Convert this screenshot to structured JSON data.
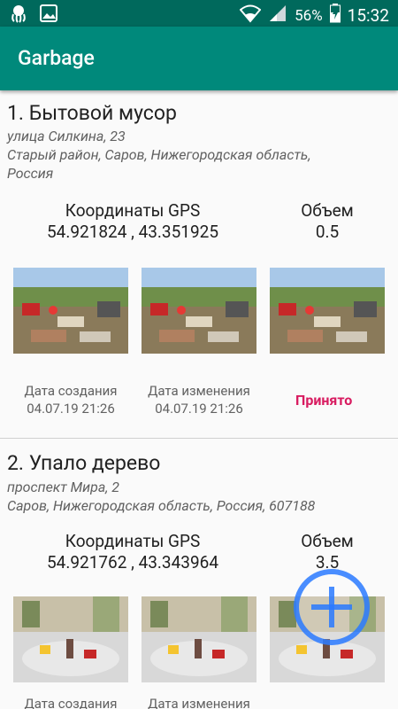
{
  "status_bar": {
    "battery": "56%",
    "time": "15:32"
  },
  "app_bar": {
    "title": "Garbage"
  },
  "items": [
    {
      "title": "1. Бытовой мусор",
      "address_line1": "улица Силкина, 23",
      "address_line2": "Старый район, Саров, Нижегородская область,",
      "address_line3": "Россия",
      "gps_label": "Координаты GPS",
      "gps_value": "54.921824 , 43.351925",
      "volume_label": "Объем",
      "volume_value": "0.5",
      "created_label": "Дата создания",
      "created_value": "04.07.19 21:26",
      "modified_label": "Дата изменения",
      "modified_value": "04.07.19 21:26",
      "status": "Принято"
    },
    {
      "title": "2. Упало дерево",
      "address_line1": "проспект Мира, 2",
      "address_line2": "Саров, Нижегородская область, Россия, 607188",
      "gps_label": "Координаты GPS",
      "gps_value": "54.921762 , 43.343964",
      "volume_label": "Объем",
      "volume_value": "3.5",
      "created_label": "Дата создания",
      "modified_label": "Дата изменения"
    }
  ],
  "icons": [
    "octopus-icon",
    "image-icon",
    "wifi-icon",
    "signal-icon",
    "battery-icon",
    "add-icon"
  ],
  "colors": {
    "status_bar": "#00695c",
    "app_bar": "#00897b",
    "status_accent": "#d81b60",
    "fab": "#2979ff"
  }
}
